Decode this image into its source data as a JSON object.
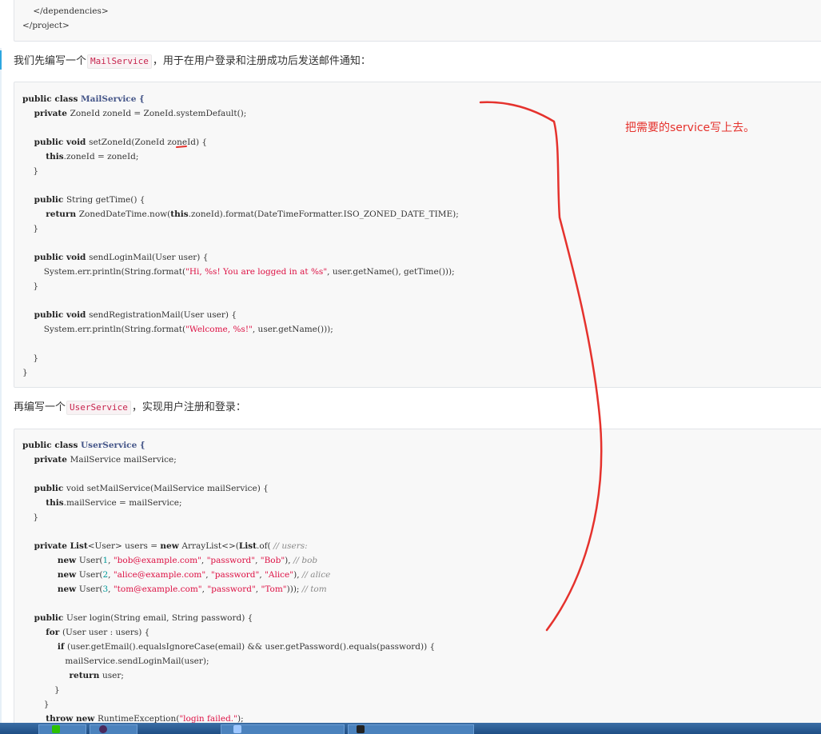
{
  "block1": {
    "lines": [
      "    </dependencies>",
      "</project>"
    ]
  },
  "para1": {
    "before": "我们先编写一个",
    "code": "MailService",
    "after": "，用于在用户登录和注册成功后发送邮件通知："
  },
  "para2": {
    "before": "再编写一个",
    "code": "UserService",
    "after": "，实现用户注册和登录："
  },
  "annotation": {
    "text": "把需要的service写上去。",
    "color": "#e5322d"
  },
  "mail_service": {
    "l01_a": "public class ",
    "l01_b": "MailService {",
    "l02_a": "    private ",
    "l02_b": "ZoneId zoneId = ZoneId.systemDefault();",
    "l04_a": "    public void ",
    "l04_b": "setZoneId(",
    "l04_c": "ZoneId",
    "l04_d": " zoneId) {",
    "l05_a": "        this",
    "l05_b": ".zoneId = zoneId;",
    "l06": "    }",
    "l08_a": "    public ",
    "l08_b": "String getTime() {",
    "l09_a": "        return ",
    "l09_b": "ZonedDateTime.now(",
    "l09_c": "this",
    "l09_d": ".zoneId).format(DateTimeFormatter.ISO_ZONED_DATE_TIME);",
    "l10": "    }",
    "l12_a": "    public void ",
    "l12_b": "sendLoginMail(User user) {",
    "l13_a": "        System.err.println(String.format(",
    "l13_b": "\"Hi, %s! You are logged in at %s\"",
    "l13_c": ", user.getName(), getTime()));",
    "l14": "    }",
    "l16_a": "    public void ",
    "l16_b": "sendRegistrationMail(User user) {",
    "l17_a": "        System.err.println(String.format(",
    "l17_b": "\"Welcome, %s!\"",
    "l17_c": ", user.getName()));",
    "l19": "    }",
    "l20": "}"
  },
  "user_service": {
    "l01_a": "public class ",
    "l01_b": "UserService {",
    "l02_a": "    private ",
    "l02_b": "MailService mailService;",
    "l04_a": "    public ",
    "l04_b": "void setMailService(MailService mailService) {",
    "l05_a": "        this",
    "l05_b": ".mailService = mailService;",
    "l06": "    }",
    "l08_a": "    private ",
    "l08_b": "List",
    "l08_c": "<User> users = ",
    "l08_d": "new ",
    "l08_e": "ArrayList<>(",
    "l08_f": "List",
    "l08_g": ".of( ",
    "l08_h": "// users:",
    "l09_a": "            new ",
    "l09_b": "User(",
    "l09_c": "1",
    "l09_d": ", ",
    "l09_e": "\"bob@example.com\"",
    "l09_f": ", ",
    "l09_g": "\"password\"",
    "l09_h": ", ",
    "l09_i": "\"Bob\"",
    "l09_j": "), ",
    "l09_k": "// bob",
    "l10_a": "            new ",
    "l10_b": "User(",
    "l10_c": "2",
    "l10_d": ", ",
    "l10_e": "\"alice@example.com\"",
    "l10_f": ", ",
    "l10_g": "\"password\"",
    "l10_h": ", ",
    "l10_i": "\"Alice\"",
    "l10_j": "), ",
    "l10_k": "// alice",
    "l11_a": "            new ",
    "l11_b": "User(",
    "l11_c": "3",
    "l11_d": ", ",
    "l11_e": "\"tom@example.com\"",
    "l11_f": ", ",
    "l11_g": "\"password\"",
    "l11_h": ", ",
    "l11_i": "\"Tom\"",
    "l11_j": "))); ",
    "l11_k": "// tom",
    "l13_a": "    public ",
    "l13_b": "User login(String email, String password) {",
    "l14_a": "        for ",
    "l14_b": "(User user : users) {",
    "l15_a": "            if ",
    "l15_b": "(user.getEmail().equalsIgnoreCase(email) && user.getPassword().equals(password)) {",
    "l16": "                mailService.sendLoginMail(user);",
    "l17_a": "                return ",
    "l17_b": "user;",
    "l18": "            }",
    "l19": "        }",
    "l20_a": "        throw new ",
    "l20_b": "RuntimeException(",
    "l20_c": "\"login failed.\"",
    "l20_d": ");"
  }
}
